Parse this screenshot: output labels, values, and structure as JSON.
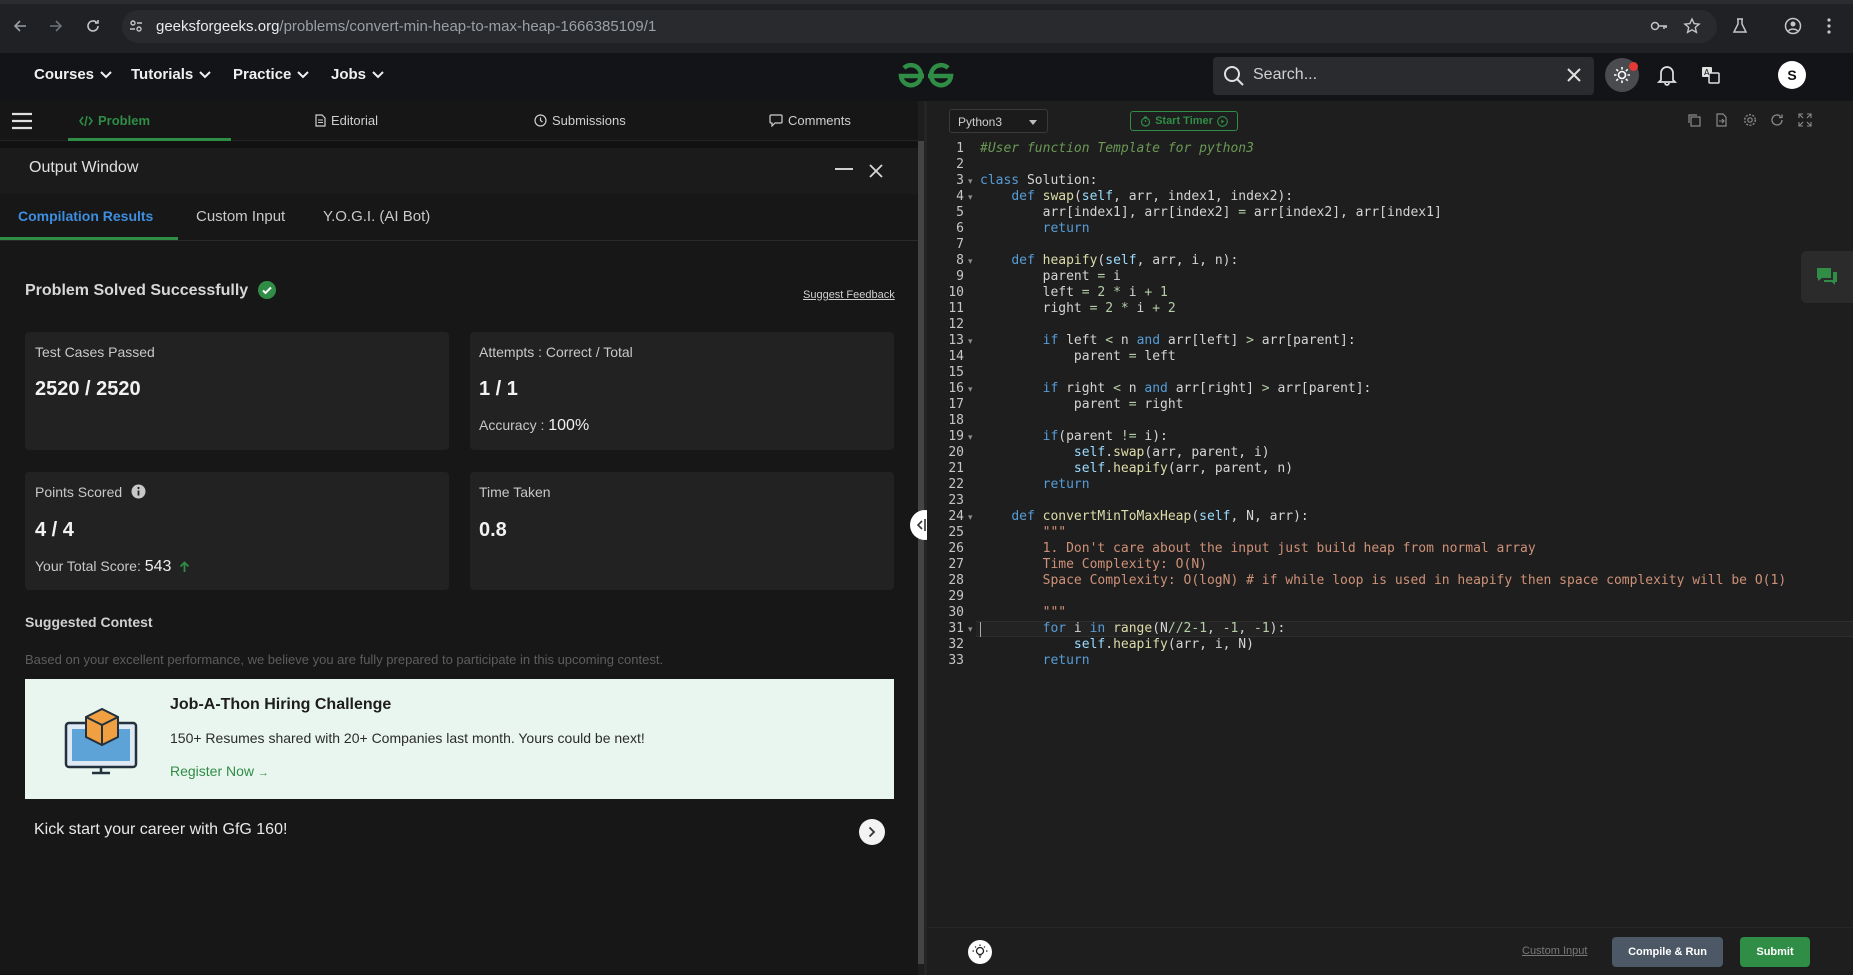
{
  "browser": {
    "url_host": "geeksforgeeks.org",
    "url_path": "/problems/convert-min-heap-to-max-heap-1666385109/1"
  },
  "header": {
    "menu": [
      {
        "label": "Courses"
      },
      {
        "label": "Tutorials"
      },
      {
        "label": "Practice"
      },
      {
        "label": "Jobs"
      }
    ],
    "search_placeholder": "Search...",
    "avatar_letter": "S"
  },
  "problem_tabs": [
    {
      "label": "Problem"
    },
    {
      "label": "Editorial"
    },
    {
      "label": "Submissions"
    },
    {
      "label": "Comments"
    }
  ],
  "output": {
    "title": "Output Window",
    "tabs": [
      {
        "label": "Compilation Results"
      },
      {
        "label": "Custom Input"
      },
      {
        "label": "Y.O.G.I. (AI Bot)"
      }
    ],
    "status": "Problem Solved Successfully",
    "feedback": "Suggest Feedback",
    "cards": {
      "tests_label": "Test Cases Passed",
      "tests_value": "2520 / 2520",
      "attempts_label": "Attempts : Correct / Total",
      "attempts_value": "1 / 1",
      "accuracy_label": "Accuracy :",
      "accuracy_value": "100%",
      "points_label": "Points Scored",
      "points_value": "4 / 4",
      "total_label": "Your Total Score:",
      "total_value": "543",
      "time_label": "Time Taken",
      "time_value": "0.8"
    },
    "contest": {
      "heading": "Suggested Contest",
      "description": "Based on your excellent performance, we believe you are fully prepared to participate in this upcoming contest.",
      "title": "Job-A-Thon Hiring Challenge",
      "body": "150+ Resumes shared with 20+ Companies last month. Yours could be next!",
      "cta": "Register Now",
      "career": "Kick start your career with GfG 160!"
    }
  },
  "editor": {
    "language": "Python3",
    "timer": "Start Timer",
    "custom_input": "Custom Input",
    "compile": "Compile & Run",
    "submit": "Submit",
    "lines": [
      "#User function Template for python3",
      "",
      "class Solution:",
      "    def swap(self, arr, index1, index2):",
      "        arr[index1], arr[index2] = arr[index2], arr[index1]",
      "        return",
      "",
      "    def heapify(self, arr, i, n):",
      "        parent = i",
      "        left = 2 * i + 1",
      "        right = 2 * i + 2",
      "",
      "        if left < n and arr[left] > arr[parent]:",
      "            parent = left",
      "",
      "        if right < n and arr[right] > arr[parent]:",
      "            parent = right",
      "",
      "        if(parent != i):",
      "            self.swap(arr, parent, i)",
      "            self.heapify(arr, parent, n)",
      "        return",
      "",
      "    def convertMinToMaxHeap(self, N, arr):",
      "        \"\"\"",
      "        1. Don't care about the input just build heap from normal array",
      "        Time Complexity: O(N)",
      "        Space Complexity: O(logN) # if while loop is used in heapify then space complexity will be O(1)",
      "",
      "        \"\"\"",
      "        for i in range(N//2-1, -1, -1):",
      "            self.heapify(arr, i, N)",
      "        return"
    ]
  }
}
